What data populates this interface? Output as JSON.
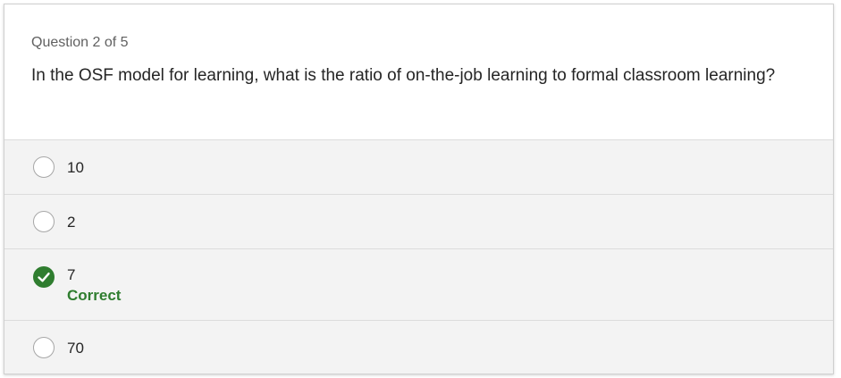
{
  "quiz": {
    "progress": "Question 2 of 5",
    "question": "In the OSF model for learning, what is the ratio of on-the-job learning to formal classroom learning?",
    "options": [
      {
        "label": "10",
        "state": "unselected"
      },
      {
        "label": "2",
        "state": "unselected"
      },
      {
        "label": "7",
        "state": "selected-correct",
        "feedback": "Correct"
      },
      {
        "label": "70",
        "state": "unselected"
      }
    ]
  },
  "colors": {
    "correct_green": "#2f7d2f",
    "option_background": "#f3f3f3",
    "divider": "#dcdcdc"
  },
  "icons": {
    "selected_option": "checkmark-circle-icon",
    "unselected_option": "radio-circle-icon"
  }
}
